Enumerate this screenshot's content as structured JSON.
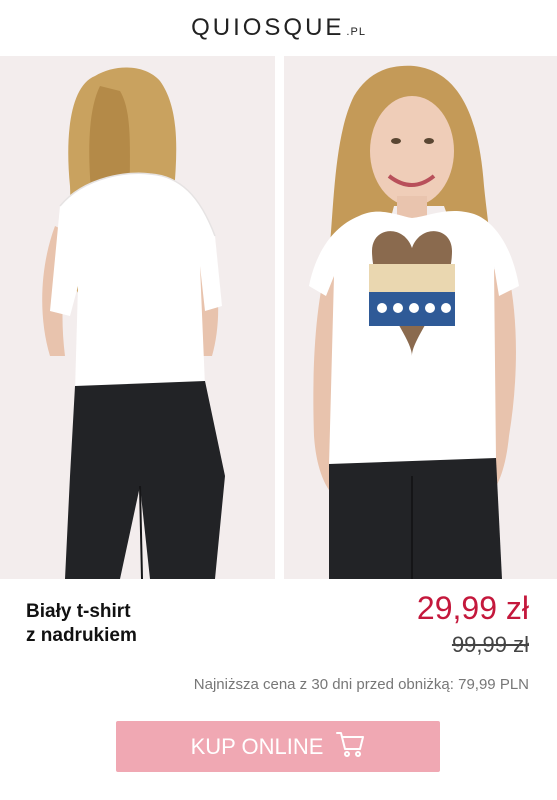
{
  "header": {
    "brand": "QUIOSQUE",
    "brand_suffix": ".PL"
  },
  "product": {
    "title_line1": "Biały t-shirt",
    "title_line2": "z nadrukiem",
    "price_current": "29,99 zł",
    "price_old": "99,99 zł",
    "lowest_price_note": "Najniższa cena z 30 dni przed obniżką: 79,99 PLN"
  },
  "cta": {
    "label": "KUP ONLINE",
    "icon": "cart-icon"
  },
  "colors": {
    "accent_price": "#c4183c",
    "button_bg": "#f0a8b3",
    "photo_bg": "#f3eded"
  }
}
